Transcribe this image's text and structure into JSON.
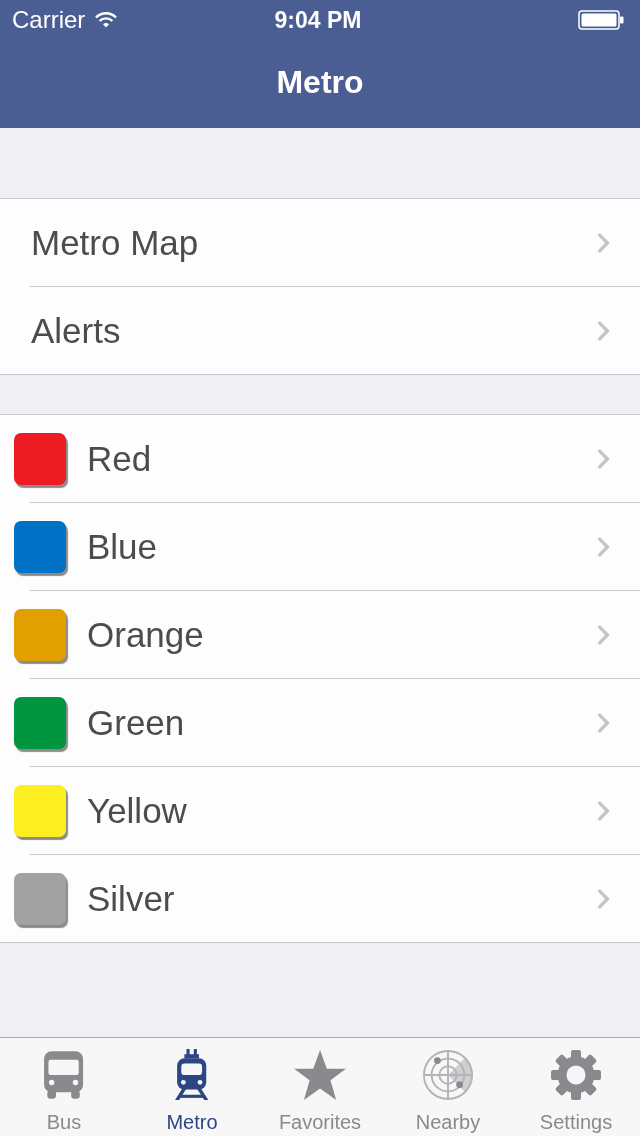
{
  "status_bar": {
    "carrier": "Carrier",
    "time": "9:04 PM"
  },
  "nav_bar": {
    "title": "Metro"
  },
  "menu_items": [
    {
      "label": "Metro Map"
    },
    {
      "label": "Alerts"
    }
  ],
  "lines": [
    {
      "label": "Red",
      "color": "#ed1c24"
    },
    {
      "label": "Blue",
      "color": "#0072c6"
    },
    {
      "label": "Orange",
      "color": "#e29f00"
    },
    {
      "label": "Green",
      "color": "#00963f"
    },
    {
      "label": "Yellow",
      "color": "#fcee21"
    },
    {
      "label": "Silver",
      "color": "#a2a2a2"
    }
  ],
  "tab_bar": [
    {
      "label": "Bus",
      "kind": "bus",
      "selected": false
    },
    {
      "label": "Metro",
      "kind": "train",
      "selected": true
    },
    {
      "label": "Favorites",
      "kind": "star",
      "selected": false
    },
    {
      "label": "Nearby",
      "kind": "radar",
      "selected": false
    },
    {
      "label": "Settings",
      "kind": "gear",
      "selected": false
    }
  ]
}
